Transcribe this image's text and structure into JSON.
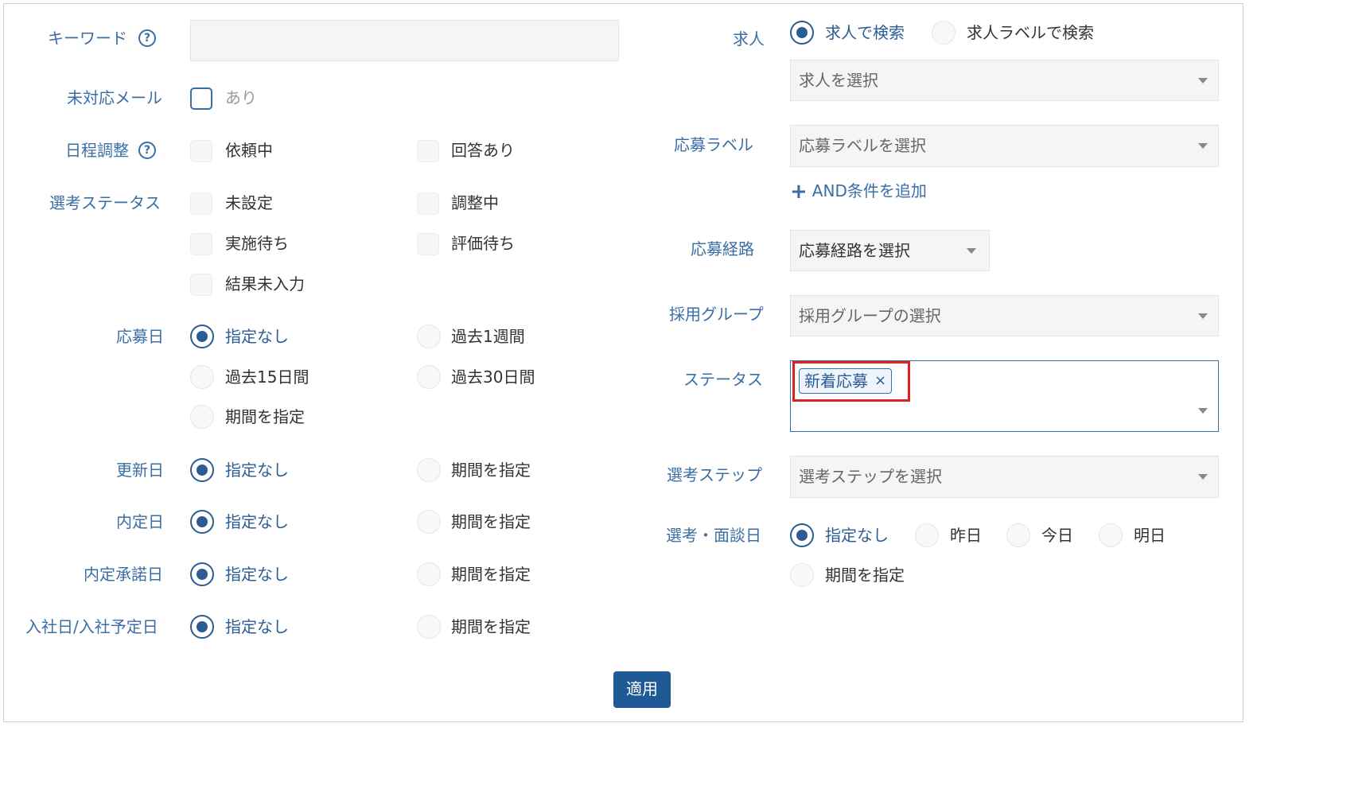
{
  "left": {
    "keyword": {
      "label": "キーワード",
      "value": ""
    },
    "unanswered_mail": {
      "label": "未対応メール",
      "option": "あり"
    },
    "schedule": {
      "label": "日程調整",
      "options": [
        "依頼中",
        "回答あり"
      ]
    },
    "selection_status": {
      "label": "選考ステータス",
      "options": [
        "未設定",
        "調整中",
        "実施待ち",
        "評価待ち",
        "結果未入力"
      ]
    },
    "applied_date": {
      "label": "応募日",
      "options": [
        "指定なし",
        "過去1週間",
        "過去15日間",
        "過去30日間",
        "期間を指定"
      ],
      "selected": "指定なし"
    },
    "updated_date": {
      "label": "更新日",
      "options": [
        "指定なし",
        "期間を指定"
      ],
      "selected": "指定なし"
    },
    "offer_date": {
      "label": "内定日",
      "options": [
        "指定なし",
        "期間を指定"
      ],
      "selected": "指定なし"
    },
    "offer_accept_date": {
      "label": "内定承諾日",
      "options": [
        "指定なし",
        "期間を指定"
      ],
      "selected": "指定なし"
    },
    "join_date": {
      "label": "入社日/入社予定日",
      "options": [
        "指定なし",
        "期間を指定"
      ],
      "selected": "指定なし"
    }
  },
  "right": {
    "job": {
      "label": "求人",
      "radio": [
        "求人で検索",
        "求人ラベルで検索"
      ],
      "selected": "求人で検索",
      "placeholder": "求人を選択"
    },
    "application_label": {
      "label": "応募ラベル",
      "placeholder": "応募ラベルを選択",
      "add_link": "AND条件を追加"
    },
    "application_route": {
      "label": "応募経路",
      "placeholder": "応募経路を選択"
    },
    "hiring_group": {
      "label": "採用グループ",
      "placeholder": "採用グループの選択"
    },
    "status": {
      "label": "ステータス",
      "tags": [
        "新着応募"
      ]
    },
    "selection_step": {
      "label": "選考ステップ",
      "placeholder": "選考ステップを選択"
    },
    "interview_date": {
      "label": "選考・面談日",
      "options": [
        "指定なし",
        "昨日",
        "今日",
        "明日",
        "期間を指定"
      ],
      "selected": "指定なし"
    }
  },
  "apply_button": "適用",
  "help_icon_glyph": "?",
  "tag_remove_glyph": "×",
  "add_glyph": "+",
  "colors": {
    "accent": "#3a6ea5",
    "button": "#1f5a96",
    "highlight": "#e02020"
  }
}
